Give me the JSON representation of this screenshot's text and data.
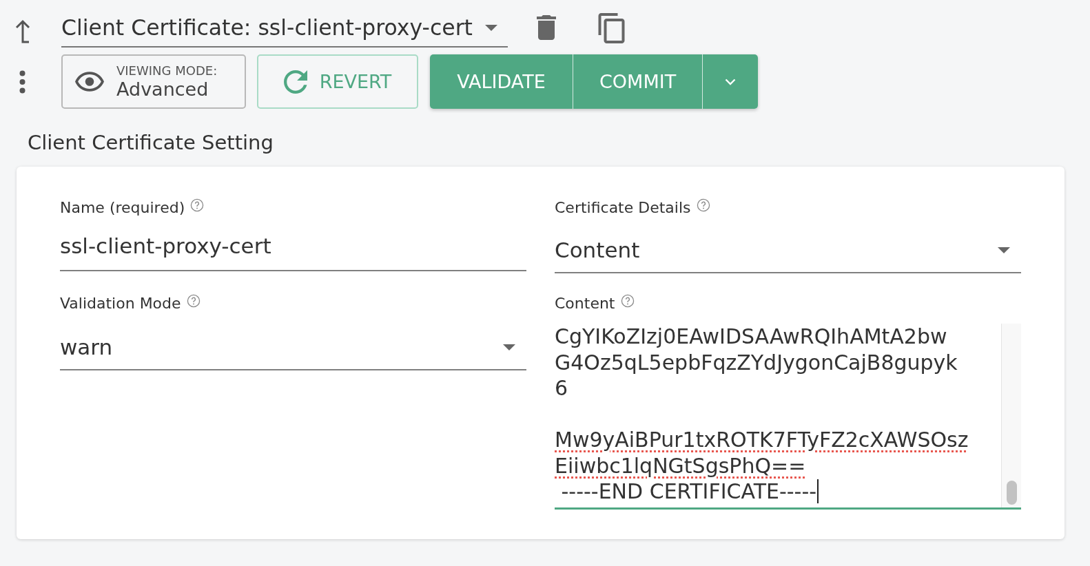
{
  "header": {
    "title_select": {
      "value": "Client Certificate: ssl-client-proxy-cert"
    }
  },
  "toolbar": {
    "viewing_mode": {
      "label": "VIEWING MODE:",
      "value": "Advanced"
    },
    "revert": {
      "label": "REVERT"
    },
    "actions": [
      {
        "label": "VALIDATE"
      },
      {
        "label": "COMMIT"
      }
    ]
  },
  "section": {
    "title": "Client Certificate Setting"
  },
  "form": {
    "fields": [
      {
        "kind": "text",
        "label": "Name (required)",
        "help": true,
        "value": "ssl-client-proxy-cert",
        "focused": false
      },
      {
        "kind": "select",
        "label": "Certificate Details",
        "help": true,
        "value": "Content",
        "focused": false
      },
      {
        "kind": "select",
        "label": "Validation Mode",
        "help": true,
        "value": "warn",
        "focused": false
      },
      {
        "kind": "textarea",
        "label": "Content",
        "help": true,
        "focused": true,
        "paragraphs": [
          {
            "lines": [
              {
                "text": "CgYIKoZIzj0EAwIDSAAwRQIhAMtA2bw",
                "misspelled": false
              },
              {
                "text": "G4Oz5qL5epbFqzZYdJygonCajB8gupyk",
                "misspelled": false
              },
              {
                "text": "6",
                "misspelled": false
              }
            ]
          },
          {
            "lines": [
              {
                "text": "Mw9yAiBPur1txROTK7FTyFZ2cXAWSOsz",
                "misspelled": true
              },
              {
                "text": "Eiiwbc1lqNGtSgsPhQ==",
                "misspelled": true
              },
              {
                "text": " -----END CERTIFICATE-----",
                "misspelled": false
              }
            ]
          }
        ]
      }
    ]
  }
}
